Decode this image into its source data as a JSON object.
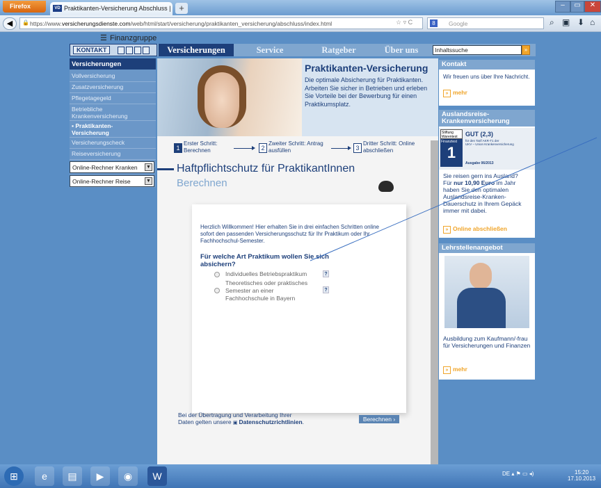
{
  "browser": {
    "menu_button": "Firefox",
    "tab_title": "Praktikanten-Versicherung Abschluss | V...",
    "tab_logo": "VD",
    "new_tab": "+",
    "url_prefix": "https://www.",
    "url_domain": "versicherungsdienste.com",
    "url_path": "/web/html/start/versicherung/praktikanten_versicherung/abschluss/index.html",
    "search_placeholder": "Google",
    "search_badge": "8"
  },
  "site": {
    "logo_text": "Finanzgruppe",
    "kontakt_label": "KONTAKT",
    "nav": [
      "Versicherungen",
      "Service",
      "Ratgeber",
      "Über uns"
    ],
    "site_search_value": "Inhaltssuche",
    "site_search_go": "»"
  },
  "sidebar": {
    "title": "Versicherungen",
    "items": [
      {
        "label": "Vollversicherung"
      },
      {
        "label": "Zusatzversicherung"
      },
      {
        "label": "Pflegetagegeld"
      },
      {
        "label": "Betriebliche\nKrankenversicherung"
      },
      {
        "label": "▪ Praktikanten-\nVersicherung"
      },
      {
        "label": "Versicherungscheck"
      },
      {
        "label": "Reiseversicherung"
      }
    ],
    "selects": [
      "Online-Rechner Kranken",
      "Online-Rechner Reise"
    ]
  },
  "hero": {
    "title": "Praktikanten-Versicherung",
    "text": "Die optimale Absicherung für Praktikanten. Arbeiten Sie sicher in Betrieben und erleben Sie Vorteile bei der Bewerbung für einen Praktikumsplatz."
  },
  "steps": [
    {
      "num": "1",
      "text": "Erster Schritt:\nBerechnen"
    },
    {
      "num": "2",
      "text": "Zweiter Schritt: Antrag\nausfüllen"
    },
    {
      "num": "3",
      "text": "Dritter Schritt: Online\nabschließen"
    }
  ],
  "form": {
    "title": "Haftpflichtschutz für PraktikantInnen",
    "subtitle": "Berechnen",
    "intro": "Herzlich Willkommen! Hier erhalten Sie in drei einfachen Schritten online sofort den passenden Versicherungsschutz für Ihr Praktikum oder Ihr Fachhochschul-Semester.",
    "question": "Für welche Art Praktikum wollen Sie sich absichern?",
    "options": [
      {
        "label": "Individuelles Betriebspraktikum"
      },
      {
        "label": "Theoretisches oder praktisches\nSemester an einer\nFachhochschule in Bayern"
      }
    ],
    "help": "?",
    "footnote_text": "Bei der Übertragung und Verarbeitung Ihrer\nDaten gelten unsere ",
    "footnote_link": "Datenschutzrichtlinien",
    "footnote_end": ".",
    "calc_button": "Berechnen"
  },
  "right": {
    "kontakt": {
      "title": "Kontakt",
      "text": "Wir freuen uns über Ihre Nachricht.",
      "mehr": "mehr"
    },
    "reise": {
      "title": "Auslandsreise-\nKrankenversicherung",
      "badge_org": "Stiftung\nWarentest",
      "badge_grade": "GUT (2,3)",
      "badge_small": "für den Tarif AKR-T1 der\nUKV – Union Krankenversicherung",
      "badge_finanztest": "Finanztest",
      "badge_date": "Ausgabe 06/2013",
      "text_before": "Sie reisen gern ins Ausland?\nFür ",
      "price": "nur 10,90 Euro",
      "text_after": " im Jahr haben Sie den optimalen Auslandsreise-Kranken-Dauerschutz in Ihrem Gepäck immer mit dabei.",
      "link": "Online abschließen"
    },
    "lehrstellen": {
      "title": "Lehrstellenangebot",
      "text": "Ausbildung zum Kaufmann/-frau für Versicherungen und Finanzen",
      "mehr": "mehr"
    }
  },
  "taskbar": {
    "lang": "DE",
    "time": "15:20",
    "date": "17.10.2013"
  },
  "colors": {
    "brand_dark": "#1d3f7a",
    "brand_light": "#7fa6cf",
    "accent_orange": "#f0a52a"
  }
}
